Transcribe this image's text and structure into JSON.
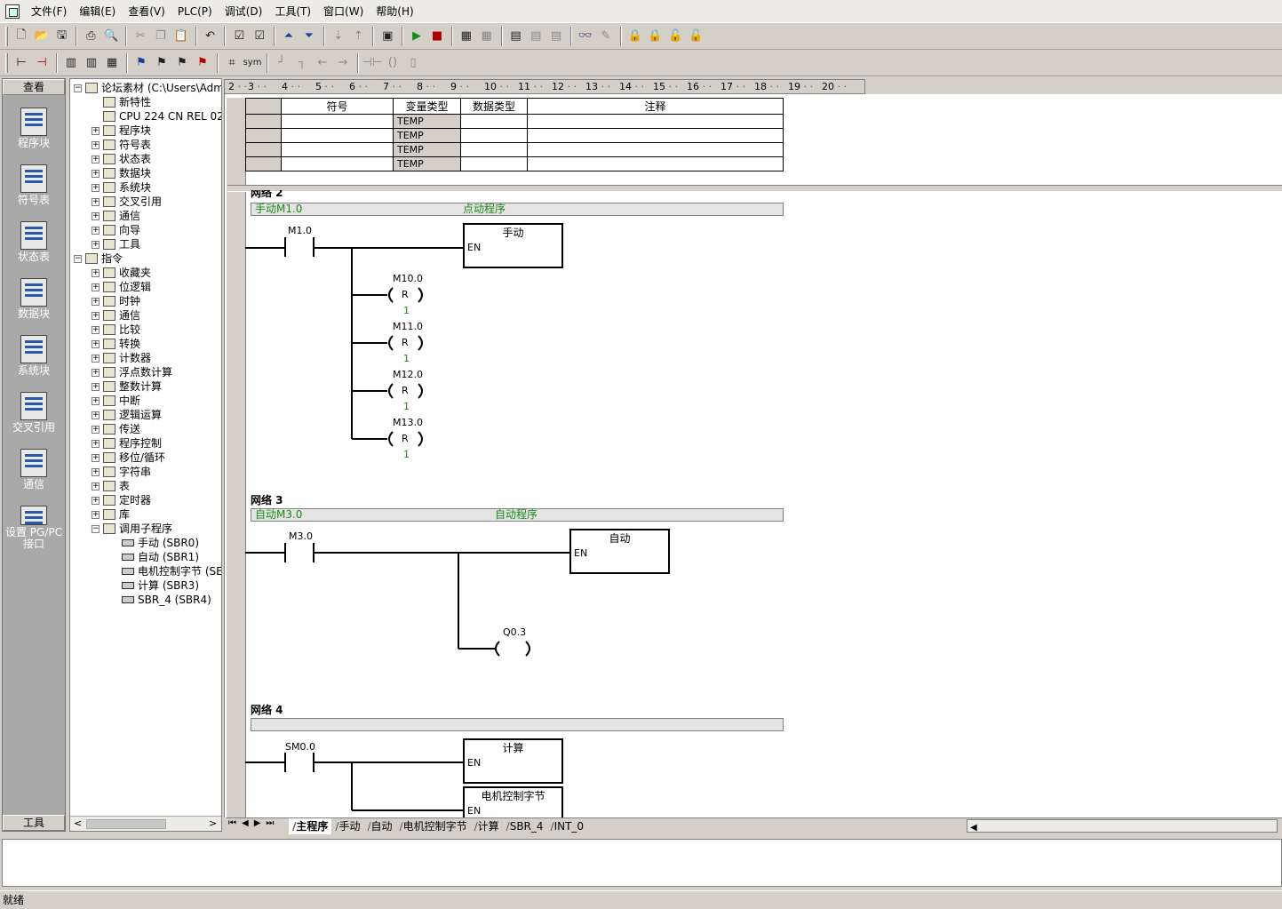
{
  "menu": [
    "文件(F)",
    "编辑(E)",
    "查看(V)",
    "PLC(P)",
    "调试(D)",
    "工具(T)",
    "窗口(W)",
    "帮助(H)"
  ],
  "nav": {
    "header": "查看",
    "footer": "工具",
    "items": [
      "程序块",
      "符号表",
      "状态表",
      "数据块",
      "系统块",
      "交叉引用",
      "通信",
      "设置 PG/PC 接口"
    ]
  },
  "tree": {
    "root": "论坛素材 (C:\\Users\\Admin",
    "project": [
      {
        "label": "新特性",
        "pm": ""
      },
      {
        "label": "CPU 224   CN REL 02.",
        "pm": ""
      },
      {
        "label": "程序块",
        "pm": "+"
      },
      {
        "label": "符号表",
        "pm": "+"
      },
      {
        "label": "状态表",
        "pm": "+"
      },
      {
        "label": "数据块",
        "pm": "+"
      },
      {
        "label": "系统块",
        "pm": "+"
      },
      {
        "label": "交叉引用",
        "pm": "+"
      },
      {
        "label": "通信",
        "pm": "+"
      },
      {
        "label": "向导",
        "pm": "+"
      },
      {
        "label": "工具",
        "pm": "+"
      }
    ],
    "instructions_label": "指令",
    "instructions": [
      "收藏夹",
      "位逻辑",
      "时钟",
      "通信",
      "比较",
      "转换",
      "计数器",
      "浮点数计算",
      "整数计算",
      "中断",
      "逻辑运算",
      "传送",
      "程序控制",
      "移位/循环",
      "字符串",
      "表",
      "定时器",
      "库",
      "调用子程序"
    ],
    "subroutines": [
      "手动 (SBR0)",
      "自动 (SBR1)",
      "电机控制字节 (SE",
      "计算 (SBR3)",
      "SBR_4 (SBR4)"
    ]
  },
  "ruler": [
    "2",
    "3",
    "4",
    "5",
    "6",
    "7",
    "8",
    "9",
    "10",
    "11",
    "12",
    "13",
    "14",
    "15",
    "16",
    "17",
    "18",
    "19",
    "20"
  ],
  "var_table": {
    "headers": [
      "符号",
      "变量类型",
      "数据类型",
      "注释"
    ],
    "rows": [
      "TEMP",
      "TEMP",
      "TEMP",
      "TEMP"
    ]
  },
  "network2": {
    "title": "网络 2",
    "comment_left": "手动M1.0",
    "comment_right": "点动程序",
    "contact": "M1.0",
    "box_title": "手动",
    "box_en": "EN",
    "coils": [
      {
        "addr": "M10.0",
        "type": "R",
        "n": "1"
      },
      {
        "addr": "M11.0",
        "type": "R",
        "n": "1"
      },
      {
        "addr": "M12.0",
        "type": "R",
        "n": "1"
      },
      {
        "addr": "M13.0",
        "type": "R",
        "n": "1"
      }
    ]
  },
  "network3": {
    "title": "网络 3",
    "comment_left": "自动M3.0",
    "comment_right": "自动程序",
    "contact": "M3.0",
    "box_title": "自动",
    "box_en": "EN",
    "coil": "Q0.3"
  },
  "network4": {
    "title": "网络 4",
    "contact": "SM0.0",
    "box1_title": "计算",
    "box1_en": "EN",
    "box2_title": "电机控制字节",
    "box2_en": "EN"
  },
  "tabs": [
    "主程序",
    "手动",
    "自动",
    "电机控制字节",
    "计算",
    "SBR_4",
    "INT_0"
  ],
  "status": "就绪"
}
